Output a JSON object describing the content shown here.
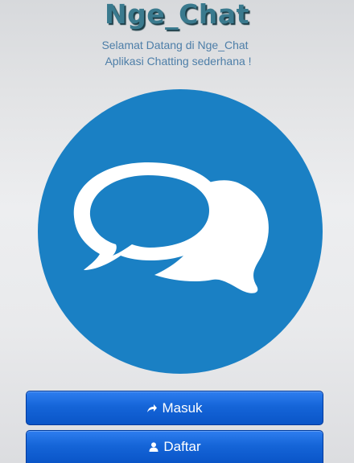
{
  "header": {
    "title": "Nge_Chat",
    "welcome_line1": "Selamat Datang di Nge_Chat",
    "welcome_line2": "Aplikasi Chatting sederhana !"
  },
  "logo": {
    "icon": "chat-bubbles-icon",
    "circle_color": "#1a80c4",
    "bubble_color": "#ffffff"
  },
  "actions": {
    "masuk": {
      "label": "Masuk",
      "icon": "share-arrow-icon"
    },
    "daftar": {
      "label": "Daftar",
      "icon": "user-icon"
    }
  },
  "colors": {
    "title": "#3a7a8e",
    "subtitle": "#4d7ea8",
    "button": "#1565d8"
  }
}
